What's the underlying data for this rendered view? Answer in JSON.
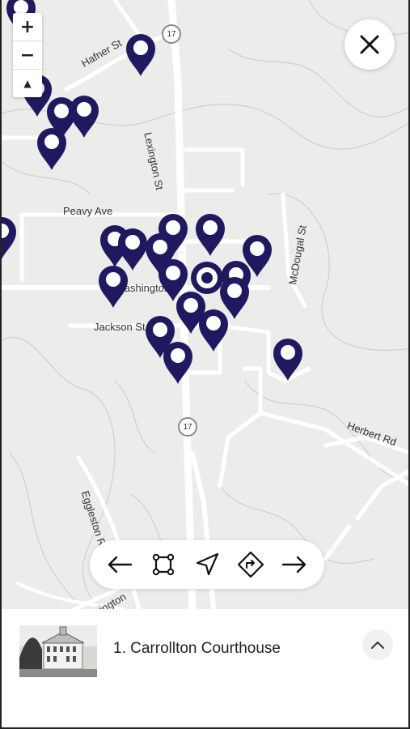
{
  "map": {
    "roads": {
      "lexington": "Lexington St",
      "hafner": "Hafner St",
      "peavy": "Peavy Ave",
      "washington": "Washington",
      "jackson": "Jackson St",
      "mcdougal": "McDougal St",
      "herbert": "Herbert Rd",
      "eggleston": "Eggleston Rd",
      "lexington_lower": "Lexington"
    },
    "route_shield": "17",
    "pin_color": "#1f1a5f",
    "selected_marker": "selected-location-marker"
  },
  "zoom": {
    "in": "+",
    "out": "−",
    "north": "▲"
  },
  "toolbar": {
    "prev": "arrow-left-icon",
    "fit": "fit-bounds-icon",
    "locate": "navigation-icon",
    "directions": "directions-icon",
    "next": "arrow-right-icon"
  },
  "place": {
    "title": "1. Carrollton Courthouse",
    "expand": "chevron-up-icon"
  }
}
